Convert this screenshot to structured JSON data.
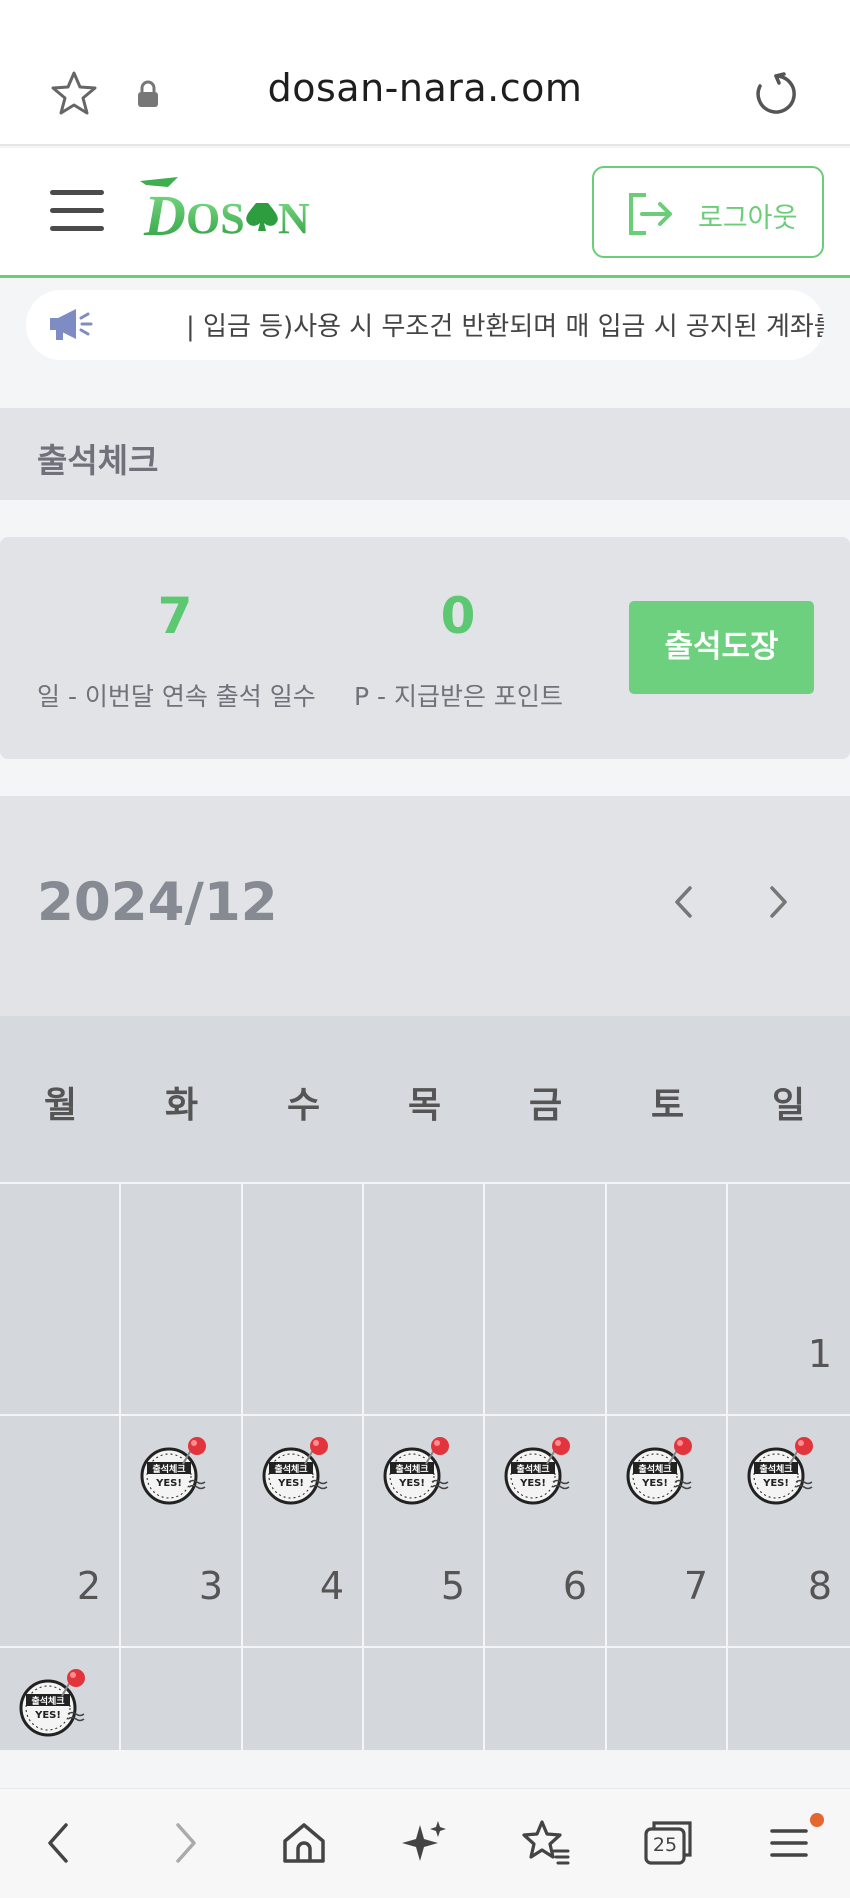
{
  "browser": {
    "url": "dosan-nara.com",
    "tab_count": "25"
  },
  "header": {
    "logo_text": "DOSAN",
    "logout_label": "로그아웃"
  },
  "notice": {
    "text": "| 입금 등)사용 시 무조건 반환되며 매 입금 시 공지된 계좌를"
  },
  "page": {
    "title": "출석체크"
  },
  "stats": {
    "consecutive_days": "7",
    "consecutive_days_label": "일 - 이번달 연속 출석 일수",
    "points": "0",
    "points_label": "P - 지급받은 포인트",
    "stamp_button": "출석도장"
  },
  "calendar": {
    "month": "2024/12",
    "weekdays": [
      "월",
      "화",
      "수",
      "목",
      "금",
      "토",
      "일"
    ],
    "weeks": [
      [
        "",
        "",
        "",
        "",
        "",
        "",
        "1"
      ],
      [
        "2",
        "3",
        "4",
        "5",
        "6",
        "7",
        "8"
      ],
      [
        "",
        "",
        "",
        "",
        "",
        "",
        ""
      ]
    ],
    "stamp_text_top": "출석체크",
    "stamp_text_bottom": "YES!",
    "stamped_days_note": "3,4,5,6,7,8,9"
  },
  "colors": {
    "accent_green": "#6ccd79",
    "panel_grey": "#e1e3e7"
  }
}
